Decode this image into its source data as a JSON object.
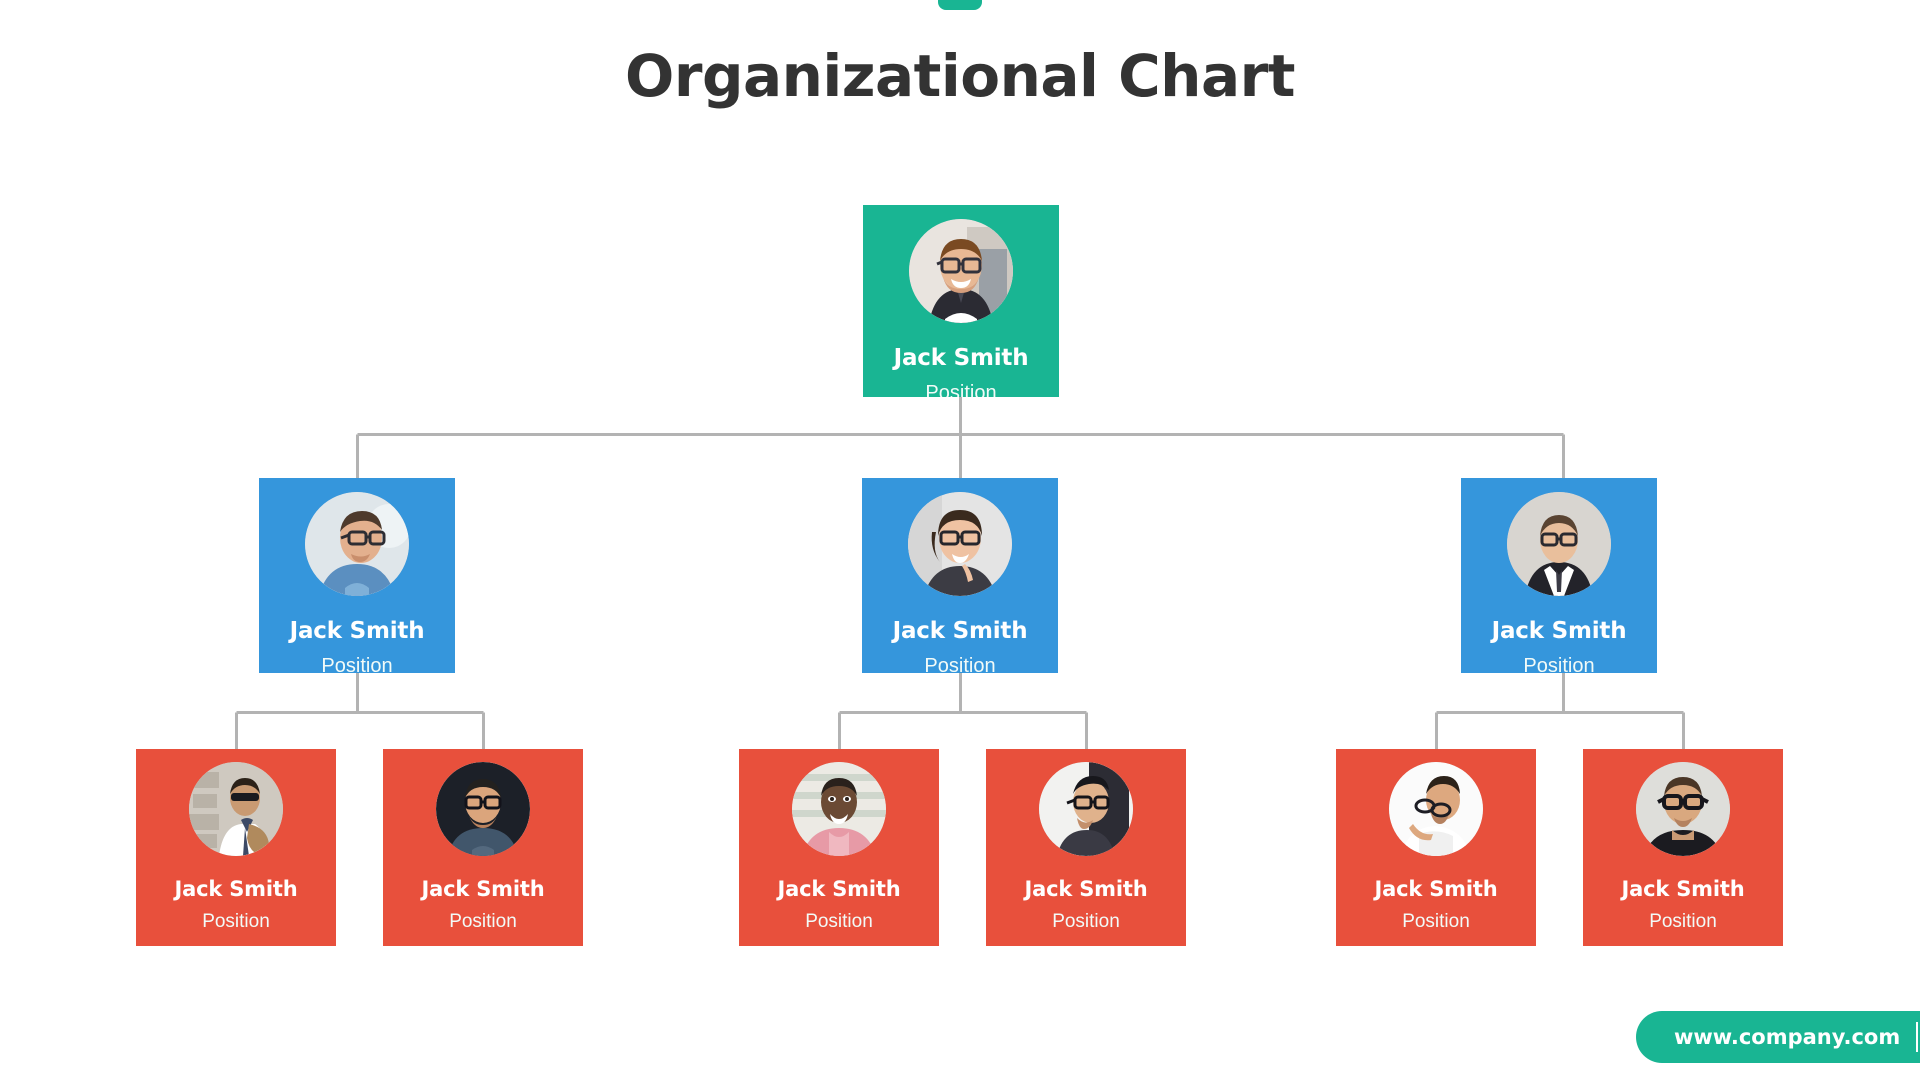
{
  "page": {
    "title": "Organizational Chart",
    "background_color": "#ffffff",
    "title_color": "#333333"
  },
  "accent": {
    "top_tab_color": "#19b593"
  },
  "theme": {
    "teal": "#19b593",
    "blue": "#3596dc",
    "red": "#e8503c",
    "connector_line": "#b3b3b3",
    "card_text": "#ffffff"
  },
  "chart_data": {
    "type": "tree",
    "title": "Organizational Chart",
    "levels": 3,
    "nodes": [
      {
        "id": "n0",
        "tier": 1,
        "name": "Jack Smith",
        "position": "Position",
        "color": "#19b593",
        "avatar": "man-glasses-beard-smiling",
        "parent": null
      },
      {
        "id": "n1",
        "tier": 2,
        "name": "Jack Smith",
        "position": "Position",
        "color": "#3596dc",
        "avatar": "man-glasses-blue-shirt",
        "parent": "n0"
      },
      {
        "id": "n2",
        "tier": 2,
        "name": "Jack Smith",
        "position": "Position",
        "color": "#3596dc",
        "avatar": "woman-glasses-smiling",
        "parent": "n0"
      },
      {
        "id": "n3",
        "tier": 2,
        "name": "Jack Smith",
        "position": "Position",
        "color": "#3596dc",
        "avatar": "man-suit-glasses-standing",
        "parent": "n0"
      },
      {
        "id": "n4",
        "tier": 3,
        "name": "Jack Smith",
        "position": "Position",
        "color": "#e8503c",
        "avatar": "man-sunglasses-jacket-wall",
        "parent": "n1"
      },
      {
        "id": "n5",
        "tier": 3,
        "name": "Jack Smith",
        "position": "Position",
        "color": "#e8503c",
        "avatar": "man-glasses-dark-background",
        "parent": "n1"
      },
      {
        "id": "n6",
        "tier": 3,
        "name": "Jack Smith",
        "position": "Position",
        "color": "#e8503c",
        "avatar": "man-pink-shirt-smiling",
        "parent": "n2"
      },
      {
        "id": "n7",
        "tier": 3,
        "name": "Jack Smith",
        "position": "Position",
        "color": "#e8503c",
        "avatar": "man-glasses-side-profile",
        "parent": "n2"
      },
      {
        "id": "n8",
        "tier": 3,
        "name": "Jack Smith",
        "position": "Position",
        "color": "#e8503c",
        "avatar": "man-white-shirt-holding-glasses",
        "parent": "n3"
      },
      {
        "id": "n9",
        "tier": 3,
        "name": "Jack Smith",
        "position": "Position",
        "color": "#e8503c",
        "avatar": "man-glasses-black-tshirt",
        "parent": "n3"
      }
    ]
  },
  "footer": {
    "url": "www.company.com",
    "badge_color": "#19b593"
  }
}
